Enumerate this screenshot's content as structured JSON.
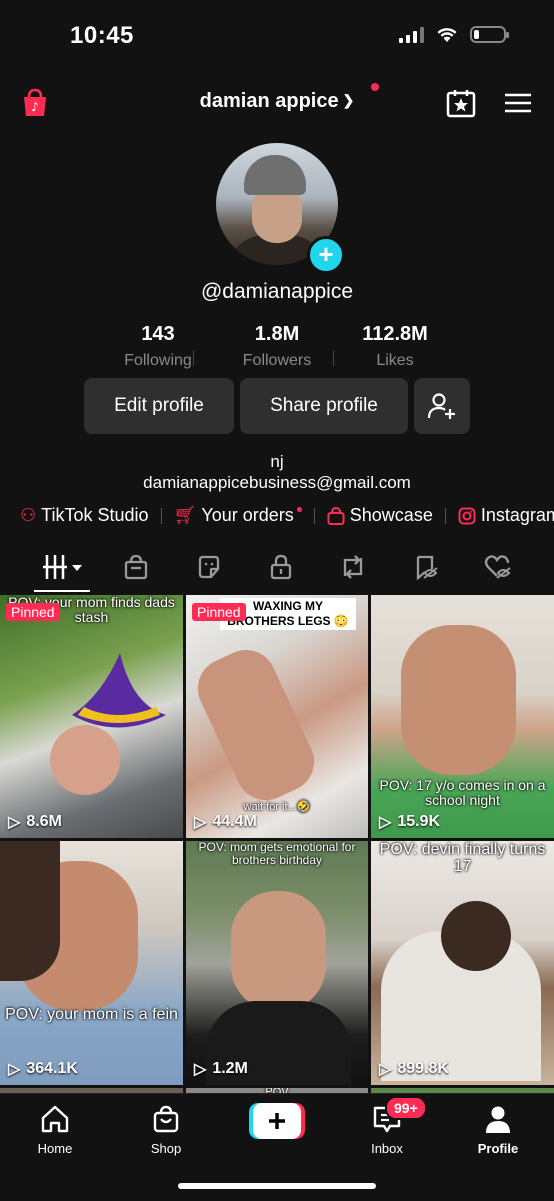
{
  "status_bar": {
    "time": "10:45"
  },
  "header": {
    "username": "damian appice"
  },
  "profile": {
    "handle": "@damianappice",
    "stats": [
      {
        "value": "143",
        "label": "Following"
      },
      {
        "value": "1.8M",
        "label": "Followers"
      },
      {
        "value": "112.8M",
        "label": "Likes"
      }
    ],
    "buttons": {
      "edit": "Edit profile",
      "share": "Share profile"
    },
    "bio": [
      "nj",
      "damianappicebusiness@gmail.com"
    ],
    "links": [
      "TikTok Studio",
      "Your orders",
      "Showcase",
      "Instagram"
    ]
  },
  "grid": {
    "videos": [
      {
        "views": "8.6M",
        "pinned": "Pinned",
        "caption": "POV: your mom finds dads stash"
      },
      {
        "views": "44.4M",
        "pinned": "Pinned",
        "caption": "WAXING MY BROTHERS LEGS 😳",
        "caption2": "wait for it...🤣"
      },
      {
        "views": "15.9K",
        "caption": "POV: 17 y/o comes in on a school night"
      },
      {
        "views": "364.1K",
        "caption": "POV: your mom is a fein"
      },
      {
        "views": "1.2M",
        "caption": "POV: mom gets emotional for brothers birthday"
      },
      {
        "views": "899.8K",
        "caption": "POV: devin finally turns 17"
      }
    ],
    "partial_caption": "POV"
  },
  "bottom_nav": {
    "items": [
      "Home",
      "Shop",
      "Inbox",
      "Profile"
    ],
    "inbox_badge": "99+"
  },
  "colors": {
    "accent": "#fe2c55",
    "teal": "#20d5ec",
    "background": "#121212",
    "button_bg": "#2f2f2f"
  }
}
